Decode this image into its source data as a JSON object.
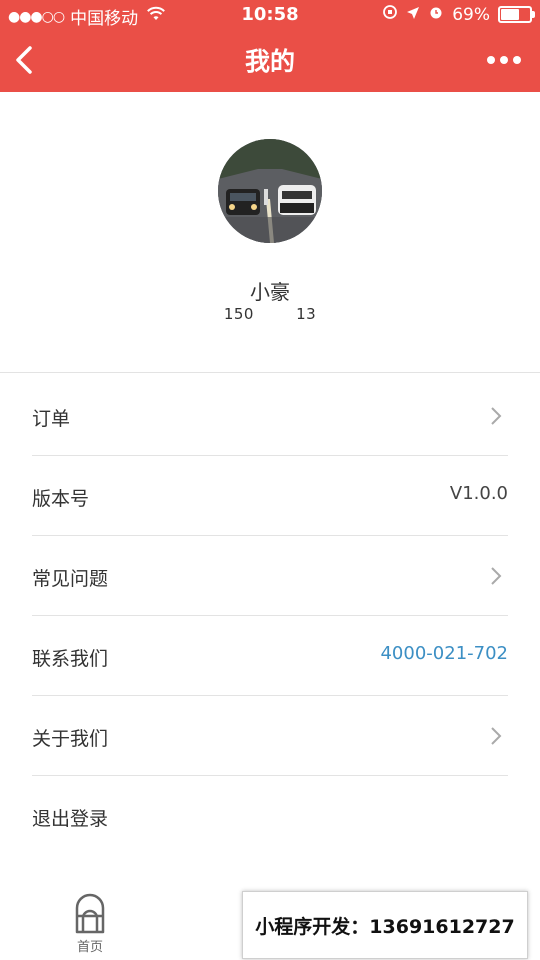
{
  "status_bar": {
    "signal": "●●●○○",
    "carrier": "中国移动",
    "time": "10:58",
    "battery_percent": "69%",
    "battery_level": 0.69
  },
  "nav": {
    "title": "我的"
  },
  "profile": {
    "name": "小豪",
    "phone": "150        13"
  },
  "menu": [
    {
      "label": "订单"
    },
    {
      "label": "版本号",
      "value": "V1.0.0"
    },
    {
      "label": "常见问题"
    },
    {
      "label": "联系我们",
      "value": "4000-021-702"
    },
    {
      "label": "关于我们"
    },
    {
      "label": "退出登录"
    }
  ],
  "tabbar": {
    "home_label": "首页"
  },
  "overlay": {
    "text": "小程序开发：13691612727"
  },
  "colors": {
    "header": "#ea4f47",
    "link": "#3c8fc4"
  }
}
